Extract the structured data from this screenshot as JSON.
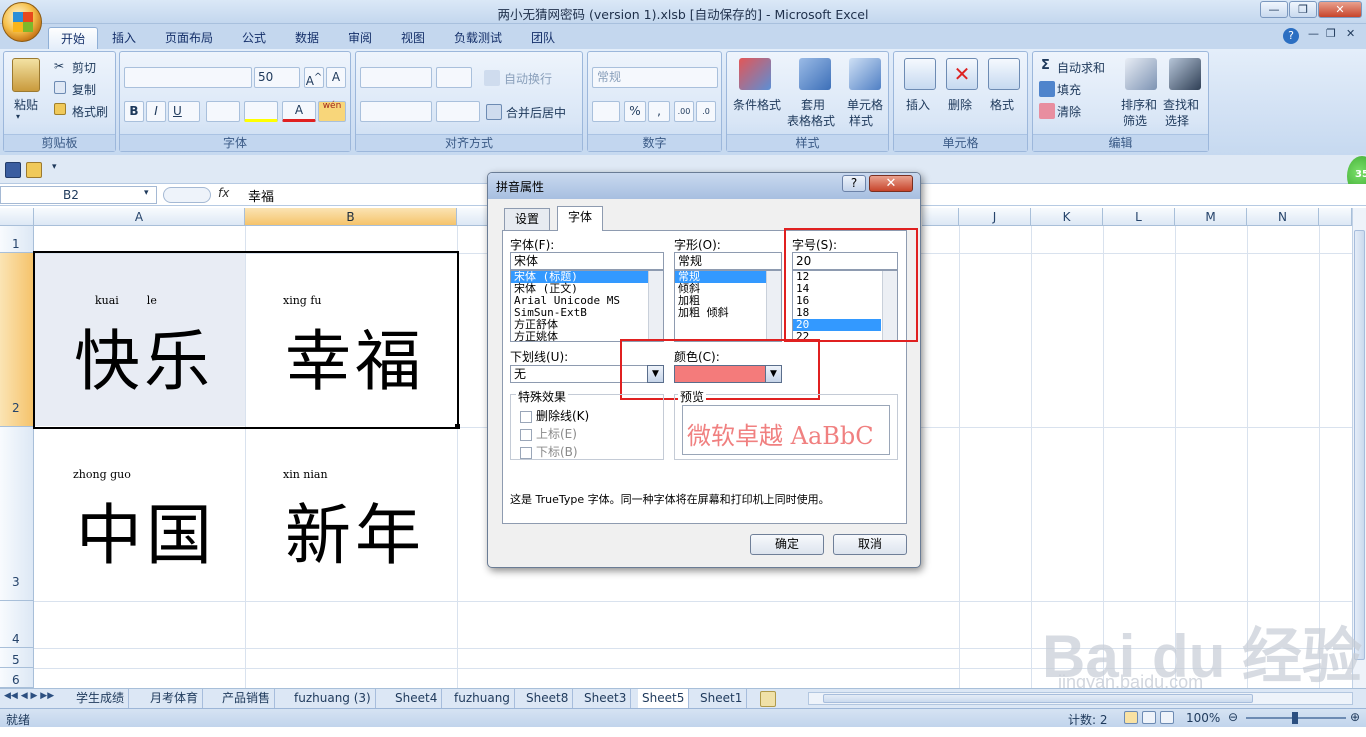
{
  "window": {
    "title": "两小无猜网密码 (version 1).xlsb [自动保存的] - Microsoft Excel"
  },
  "ribbon": {
    "tabs": [
      "开始",
      "插入",
      "页面布局",
      "公式",
      "数据",
      "审阅",
      "视图",
      "负载测试",
      "团队"
    ],
    "clipboard": {
      "paste": "粘贴",
      "cut": "剪切",
      "copy": "复制",
      "format_painter": "格式刷",
      "label": "剪贴板"
    },
    "font": {
      "name": "",
      "size": "50",
      "label": "字体",
      "bold": "B",
      "italic": "I",
      "underline": "U",
      "wen": "wén"
    },
    "align": {
      "wrap": "自动换行",
      "merge": "合并后居中",
      "label": "对齐方式"
    },
    "number": {
      "format": "常规",
      "label": "数字",
      "percent": "%",
      "comma": ",",
      "inc": ".00",
      "dec": ".0"
    },
    "styles": {
      "cond": "条件格式",
      "table": "套用",
      "table2": "表格格式",
      "cell": "单元格",
      "cell2": "样式",
      "label": "样式"
    },
    "cells": {
      "insert": "插入",
      "delete": "删除",
      "format": "格式",
      "label": "单元格"
    },
    "edit": {
      "autosum": "自动求和",
      "fill": "填充",
      "clear": "清除",
      "sort": "排序和",
      "sort2": "筛选",
      "find": "查找和",
      "find2": "选择",
      "label": "编辑"
    }
  },
  "formula": {
    "name_box": "B2",
    "fx": "fx",
    "content": "幸福"
  },
  "grid": {
    "columns": [
      "A",
      "B",
      "",
      "",
      "",
      "",
      "",
      "",
      "",
      "J",
      "K",
      "L",
      "M",
      "N"
    ],
    "rows": [
      "1",
      "2",
      "3",
      "4",
      "5",
      "6"
    ],
    "cells": [
      {
        "pinyin": "kuai        le",
        "text": "快乐"
      },
      {
        "pinyin": "xing fu",
        "text": "幸福"
      },
      {
        "pinyin": "zhong guo",
        "text": "中国"
      },
      {
        "pinyin": "xin nian",
        "text": "新年"
      }
    ]
  },
  "sheets": [
    "学生成绩",
    "月考体育",
    "产品销售",
    "fuzhuang (3)",
    "Sheet4",
    "fuzhuang",
    "Sheet8",
    "Sheet3",
    "Sheet5",
    "Sheet1"
  ],
  "status": {
    "ready": "就绪",
    "count": "计数: 2",
    "zoom": "100%"
  },
  "dialog": {
    "title": "拼音属性",
    "help": "?",
    "close": "✕",
    "tabs": [
      "设置",
      "字体"
    ],
    "font_label": "字体(F):",
    "font_value": "宋体",
    "fonts": [
      "宋体 (标题)",
      "宋体 (正文)",
      "Arial Unicode MS",
      "SimSun-ExtB",
      "方正舒体",
      "方正姚体"
    ],
    "style_label": "字形(O):",
    "style_value": "常规",
    "styles": [
      "常规",
      "倾斜",
      "加粗",
      "加粗 倾斜"
    ],
    "size_label": "字号(S):",
    "size_value": "20",
    "sizes": [
      "12",
      "14",
      "16",
      "18",
      "20",
      "22"
    ],
    "underline_label": "下划线(U):",
    "underline_value": "无",
    "color_label": "颜色(C):",
    "effects_label": "特殊效果",
    "strike": "删除线(K)",
    "superscript": "上标(E)",
    "subscript": "下标(B)",
    "preview_label": "预览",
    "preview_text": "微软卓越  AaBbC",
    "note": "这是 TrueType 字体。同一种字体将在屏幕和打印机上同时使用。",
    "ok": "确定",
    "cancel": "取消",
    "color_hex": "#f47b7b"
  },
  "watermark": {
    "main": "Bai du 经验",
    "sub": "jingyan.baidu.com"
  },
  "badge": "35"
}
